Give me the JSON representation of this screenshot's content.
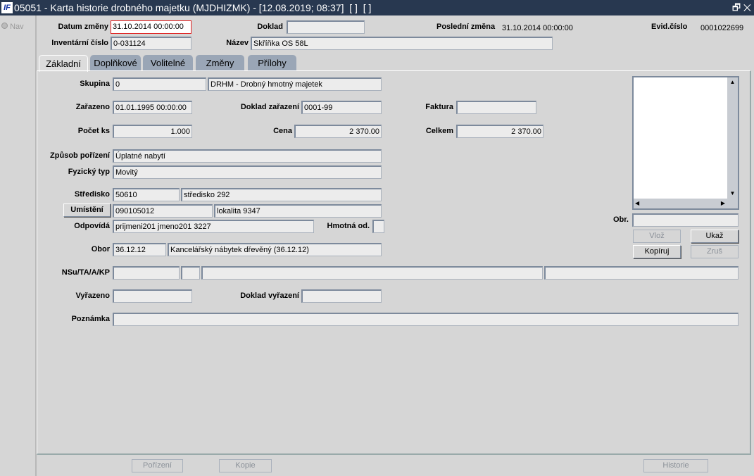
{
  "window": {
    "title": "05051 - Karta historie drobného majetku (MJDHIZMK) - [12.08.2019; 08:37]  [ ]  [ ]",
    "logo": "IF",
    "restore_icon": "restore-icon",
    "close_icon": "close-icon",
    "restore": "🗗",
    "close": "✕"
  },
  "nav": {
    "label": "Nav"
  },
  "header": {
    "datum_zmeny_label": "Datum změny",
    "datum_zmeny": "31.10.2014 00:00:00",
    "doklad_label": "Doklad",
    "doklad": "",
    "posledni_zmena_label": "Poslední změna",
    "posledni_zmena": "31.10.2014 00:00:00",
    "evid_cislo_label": "Evid.číslo",
    "evid_cislo": "0001022699",
    "inventarni_cislo_label": "Inventární číslo",
    "inventarni_cislo": "0-031124",
    "nazev_label": "Název",
    "nazev": "Skříňka OS 58L"
  },
  "tabs": [
    "Základní",
    "Doplňkové",
    "Volitelné",
    "Změny",
    "Přílohy"
  ],
  "form": {
    "skupina_label": "Skupina",
    "skupina": "0",
    "skupina_nazev": "DRHM - Drobný hmotný majetek",
    "zarazeno_label": "Zařazeno",
    "zarazeno": "01.01.1995 00:00:00",
    "doklad_zarazeni_label": "Doklad zařazení",
    "doklad_zarazeni": "0001-99",
    "faktura_label": "Faktura",
    "faktura": "",
    "pocet_ks_label": "Počet ks",
    "pocet_ks": "1.000",
    "cena_label": "Cena",
    "cena": "2 370.00",
    "celkem_label": "Celkem",
    "celkem": "2 370.00",
    "zpusob_porizeni_label": "Způsob pořízení",
    "zpusob_porizeni": "Úplatné nabytí",
    "fyzicky_typ_label": "Fyzický typ",
    "fyzicky_typ": "Movitý",
    "stredisko_label": "Středisko",
    "stredisko": "50610",
    "stredisko_nazev": "středisko 292",
    "umisteni_label": "Umístění",
    "umisteni": "090105012",
    "umisteni_nazev": "lokalita 9347",
    "odpovida_label": "Odpovídá",
    "odpovida": "prijmeni201 jmeno201 3227",
    "hmotna_od_label": "Hmotná od.",
    "obor_label": "Obor",
    "obor": "36.12.12",
    "obor_nazev": "Kancelářský nábytek dřevěný (36.12.12)",
    "nsu_label": "NSu/TA/A/KP",
    "vyrazeno_label": "Vyřazeno",
    "vyrazeno": "",
    "doklad_vyrazeni_label": "Doklad vyřazení",
    "doklad_vyrazeni": "",
    "poznamka_label": "Poznámka",
    "poznamka": ""
  },
  "image": {
    "obr_label": "Obr.",
    "obr": "",
    "vloz": "Vlož",
    "ukaz": "Ukaž",
    "kopiruj": "Kopíruj",
    "zrus": "Zruš"
  },
  "footer": {
    "porizeni": "Pořízení",
    "kopie": "Kopie",
    "historie": "Historie"
  }
}
